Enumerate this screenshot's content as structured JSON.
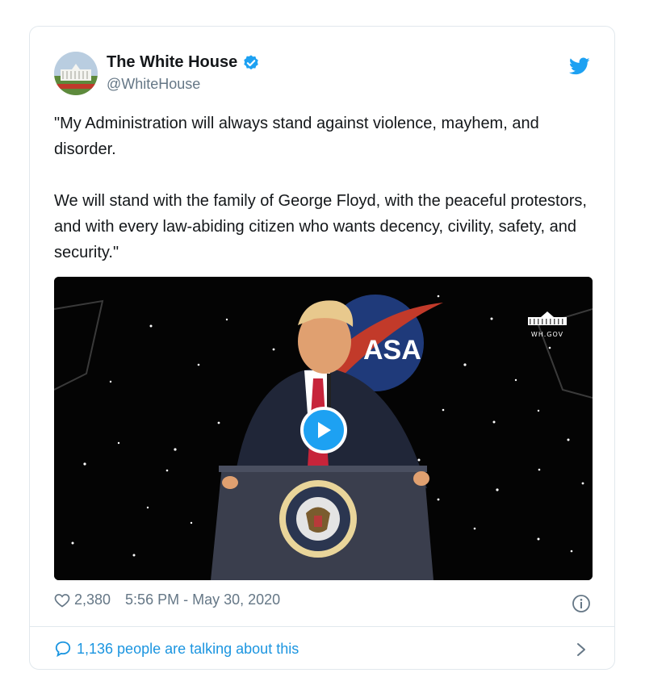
{
  "tweet": {
    "author_name": "The White House",
    "author_handle": "@WhiteHouse",
    "verified": true,
    "text": "\"My Administration will always stand against violence, mayhem, and disorder.\n\nWe will stand with the family of George Floyd, with the peaceful protestors, and with every law-abiding citizen who wants decency, civility, safety, and security.\"",
    "media": {
      "type": "video",
      "watermark": "WH.GOV",
      "backdrop_text": "ASA",
      "seal_text": "SEAL OF THE PRESIDENT OF THE UNITED STATES"
    },
    "likes": "2,380",
    "timestamp": "5:56 PM - May 30, 2020",
    "talking_label": "1,136 people are talking about this"
  },
  "icons": {
    "bird": "twitter-bird-icon",
    "verified": "verified-badge-icon",
    "play": "play-icon",
    "heart": "heart-icon",
    "info": "info-icon",
    "comment": "comment-bubble-icon",
    "chevron": "chevron-right-icon"
  },
  "colors": {
    "accent": "#1da1f2",
    "link": "#1b95e0",
    "muted": "#657786",
    "text": "#14171a",
    "border": "#e1e8ed"
  }
}
